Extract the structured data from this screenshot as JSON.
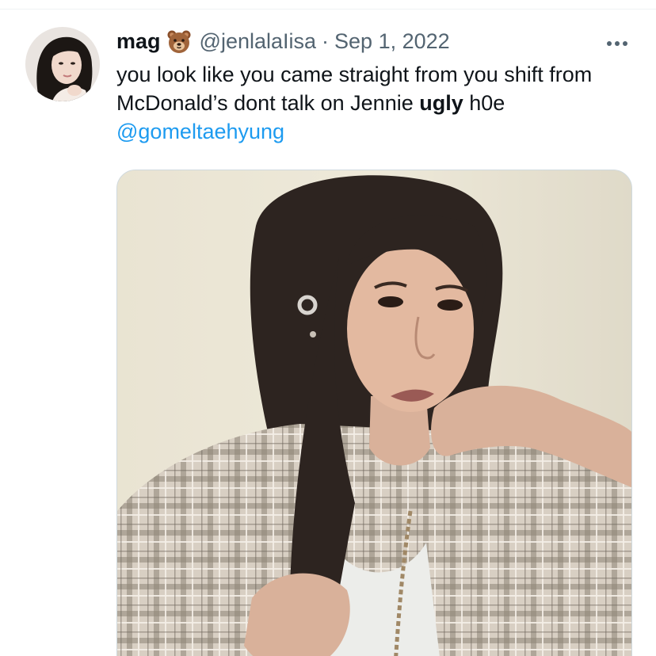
{
  "tweet": {
    "author": {
      "display_name": "mag",
      "handle": "@jenlalaIisa",
      "badge_icon": "bear-face-emoji"
    },
    "separator": "·",
    "date": "Sep 1, 2022",
    "text": {
      "part1": "you look like you came straight from you shift from McDonald’s dont talk on Jennie ",
      "bold": "ugly",
      "part2": " h0e"
    },
    "mention": "@gomeltaehyung",
    "more_icon": "more-horizontal-icon"
  },
  "colors": {
    "primary_text": "#0f1419",
    "secondary_text": "#536471",
    "link": "#1d9bf0",
    "border": "#cfd9de"
  }
}
